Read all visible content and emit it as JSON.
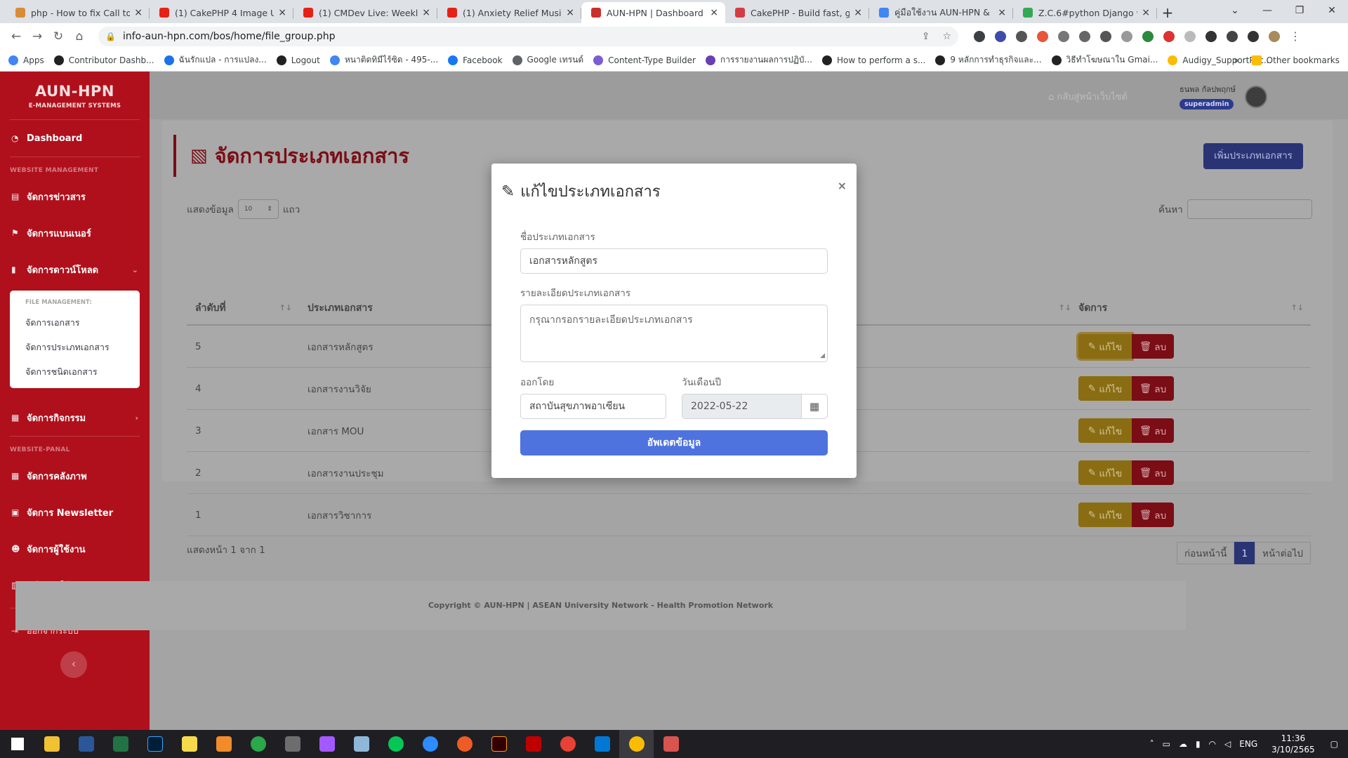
{
  "browser": {
    "tabs": [
      {
        "title": "php - How to fix Call to un",
        "color": "#d98b3a"
      },
      {
        "title": "(1) CakePHP 4 Image Uplo",
        "color": "#e62117"
      },
      {
        "title": "(1) CMDev Live: Weekly Up",
        "color": "#e62117"
      },
      {
        "title": "(1) Anxiety Relief Music | F",
        "color": "#e62117"
      },
      {
        "title": "AUN-HPN | Dashboard",
        "color": "#c9302c",
        "active": true
      },
      {
        "title": "CakePHP - Build fast, grow",
        "color": "#d33c44"
      },
      {
        "title": "คู่มือใช้งาน AUN-HPN & INF",
        "color": "#4285f4"
      },
      {
        "title": "Z.C.6#python Django web",
        "color": "#34a853"
      }
    ],
    "url": "info-aun-hpn.com/bos/home/file_group.php",
    "bookmarks": [
      {
        "label": "Apps",
        "color": "#4285f4"
      },
      {
        "label": "Contributor Dashb...",
        "color": "#222"
      },
      {
        "label": "ฉันรักแปล - การแปลง...",
        "color": "#1a73e8"
      },
      {
        "label": "Logout",
        "color": "#222"
      },
      {
        "label": "หนาติดทิมีไร้ซิด - 495-...",
        "color": "#4285f4"
      },
      {
        "label": "Facebook",
        "color": "#1877f2"
      },
      {
        "label": "Google เทรนด์",
        "color": "#5f6368"
      },
      {
        "label": "Content-Type Builder",
        "color": "#7b5cd6"
      },
      {
        "label": "การรายงานผลการปฏิบั...",
        "color": "#6a3fb5"
      },
      {
        "label": "How to perform a s...",
        "color": "#222"
      },
      {
        "label": "9 หลักการทำธุรกิจและ...",
        "color": "#222"
      },
      {
        "label": "วิธีทำโฆษณาใน Gmai...",
        "color": "#222"
      },
      {
        "label": "Audigy_SupportPac...",
        "color": "#fbbc04"
      }
    ],
    "other_bookmarks": "Other bookmarks"
  },
  "sidebar": {
    "brand_name": "AUN-HPN",
    "brand_sub": "E-MANAGEMENT SYSTEMS",
    "dashboard": "Dashboard",
    "website_management": "WEBSITE MANAGEMENT",
    "news": "จัดการข่าวสาร",
    "banner": "จัดการแบนเนอร์",
    "download": "จัดการดาวน์โหลด",
    "file_management": "FILE MANAGEMENT:",
    "sub_docs": "จัดการเอกสาร",
    "sub_doc_types": "จัดการประเภทเอกสาร",
    "sub_doc_kinds": "จัดการชนิดเอกสาร",
    "activities": "จัดการกิจกรรม",
    "website_panel": "WEBSITE-PANAL",
    "gallery": "จัดการคลังภาพ",
    "newsletter": "จัดการ Newsletter",
    "users": "จัดการผู้ใช้งาน",
    "manual": "คู่มือการใช้งาน",
    "logout": "ออกจากระบบ"
  },
  "topbar": {
    "home_link": "กลับสู่หน้าเว็บไซต์",
    "user_name": "ธนพล กัลปพฤกษ์",
    "role": "superadmin"
  },
  "page": {
    "title": "จัดการประเภทเอกสาร",
    "add_button": "เพิ่มประเภทเอกสาร",
    "show_label": "แสดงข้อมูล",
    "show_value": "10",
    "rows_label": "แถว",
    "search_label": "ค้นหา",
    "columns": [
      "ลำดับที่",
      "ประเภทเอกสาร",
      "จัดการ"
    ],
    "rows": [
      {
        "no": "5",
        "type": "เอกสารหลักสูตร"
      },
      {
        "no": "4",
        "type": "เอกสารงานวิจัย"
      },
      {
        "no": "3",
        "type": "เอกสาร MOU"
      },
      {
        "no": "2",
        "type": "เอกสารงานประชุม"
      },
      {
        "no": "1",
        "type": "เอกสารวิชาการ"
      }
    ],
    "edit_label": "แก้ไข",
    "delete_label": "ลบ",
    "info": "แสดงหน้า 1 จาก 1",
    "prev": "ก่อนหน้านี้",
    "current_page": "1",
    "next": "หน้าต่อไป",
    "footer": "Copyright © AUN-HPN | ASEAN University Network - Health Promotion Network"
  },
  "modal": {
    "title": "แก้ไขประเภทเอกสาร",
    "name_label": "ชื่อประเภทเอกสาร",
    "name_value": "เอกสารหลักสูตร",
    "detail_label": "รายละเอียดประเภทเอกสาร",
    "detail_placeholder": "กรุณากรอกรายละเอียดประเภทเอกสาร",
    "issuer_label": "ออกโดย",
    "issuer_value": "สถาบันสุขภาพอาเซียน",
    "date_label": "วันเดือนปี",
    "date_value": "2022-05-22",
    "submit": "อัพเดตข้อมูล",
    "close": "×"
  },
  "taskbar": {
    "lang": "ENG",
    "time": "11:36",
    "date": "3/10/2565"
  }
}
